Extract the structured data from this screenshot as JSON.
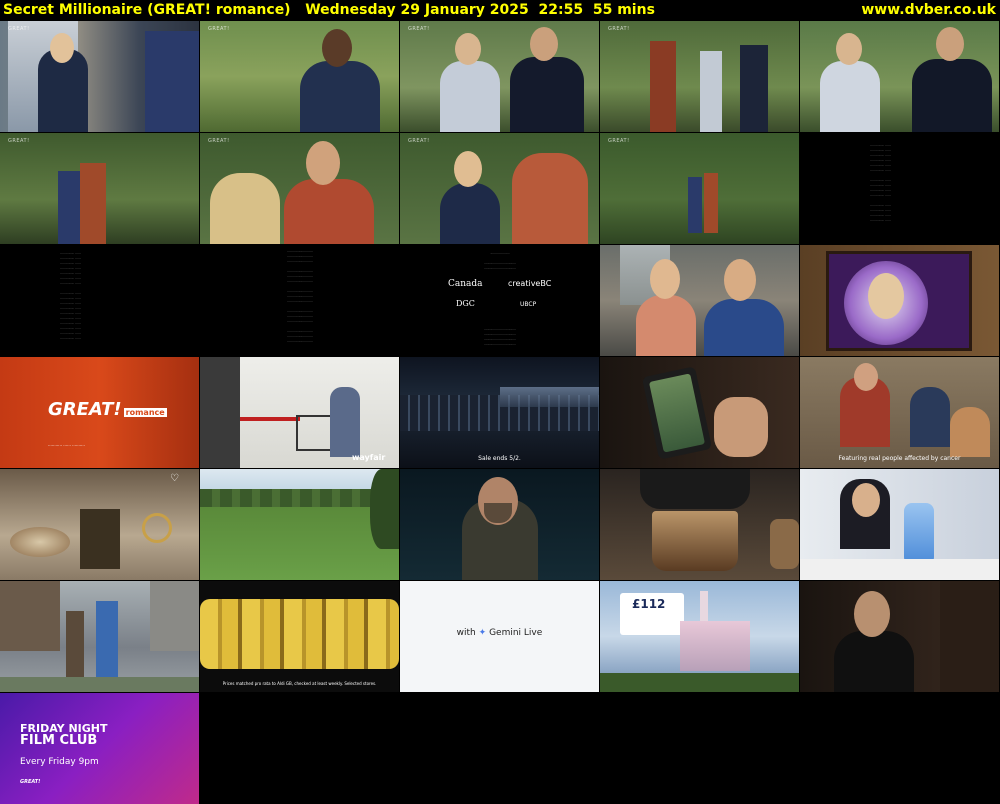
{
  "header": {
    "title": "Secret Millionaire (GREAT! romance)",
    "date": "Wednesday 29 January 2025",
    "time": "22:55",
    "duration": "55 mins",
    "site": "www.dvber.co.uk"
  },
  "thumbs": {
    "great_logo": "GREAT!",
    "great_logo_sub": "romance",
    "wayfair": "wayfair",
    "sale_text": "Sale ends 5/2.",
    "featuring_text": "Featuring real people affected by cancer",
    "gemini_with": "with",
    "gemini_name": "Gemini Live",
    "bananas_text": "Prices matched pro rata to Aldi GB, checked at least weekly. Selected stores.",
    "canada": "Canada",
    "creative_bc": "creativeBC",
    "dgc": "DGC",
    "ubcp": "UBCP",
    "price": "£112",
    "friday_night": "FRIDAY NIGHT",
    "film_club": "FILM CLUB",
    "every_friday": "Every Friday 9pm",
    "channel_tag": "GREAT!"
  },
  "colors": {
    "header_text": "#ffff00",
    "background": "#000000",
    "great_orange": "#d9491a",
    "film_club_purple": "#8a1fc2"
  }
}
